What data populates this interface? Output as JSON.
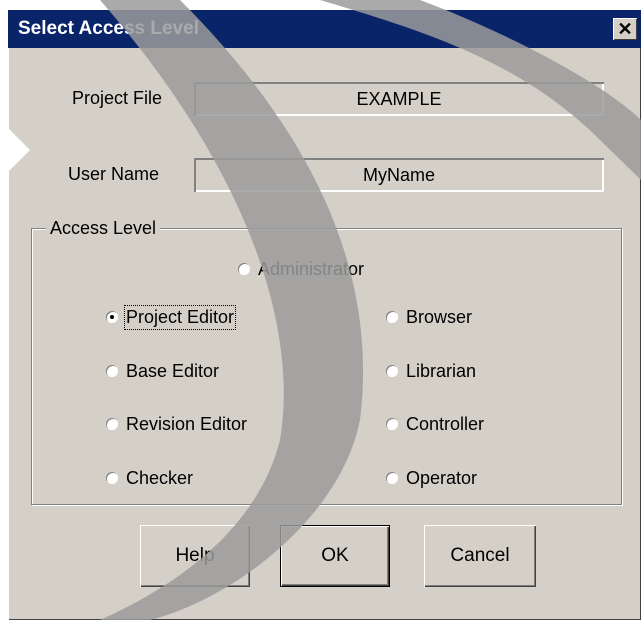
{
  "window": {
    "title": "Select Access Level",
    "close_glyph": "✕"
  },
  "fields": {
    "project_file": {
      "label": "Project File",
      "value": "EXAMPLE"
    },
    "user_name": {
      "label": "User Name",
      "value": "MyName"
    }
  },
  "access_level": {
    "group_label": "Access Level",
    "selected": "Project Editor",
    "options": {
      "administrator": {
        "label": "Administrator",
        "access_key": "A"
      },
      "project_editor": {
        "label": "Project Editor",
        "access_key": "P"
      },
      "base_editor": {
        "label": "Base Editor",
        "access_key": "B"
      },
      "revision_editor": {
        "label": "Revision Editor",
        "access_key": "R"
      },
      "checker": {
        "label": "Checker",
        "access_key": "C"
      },
      "browser": {
        "label": "Browser",
        "access_key": "r"
      },
      "librarian": {
        "label": "Librarian",
        "access_key": "L"
      },
      "controller": {
        "label": "Controller",
        "access_key": "n"
      },
      "operator": {
        "label": "Operator",
        "access_key": "O"
      }
    }
  },
  "buttons": {
    "help": "Help",
    "ok": "OK",
    "cancel": "Cancel"
  },
  "colors": {
    "titlebar": "#0a246a",
    "dialog_face": "#d4d0c8",
    "overlay_stripe": "#9b9b9b"
  }
}
